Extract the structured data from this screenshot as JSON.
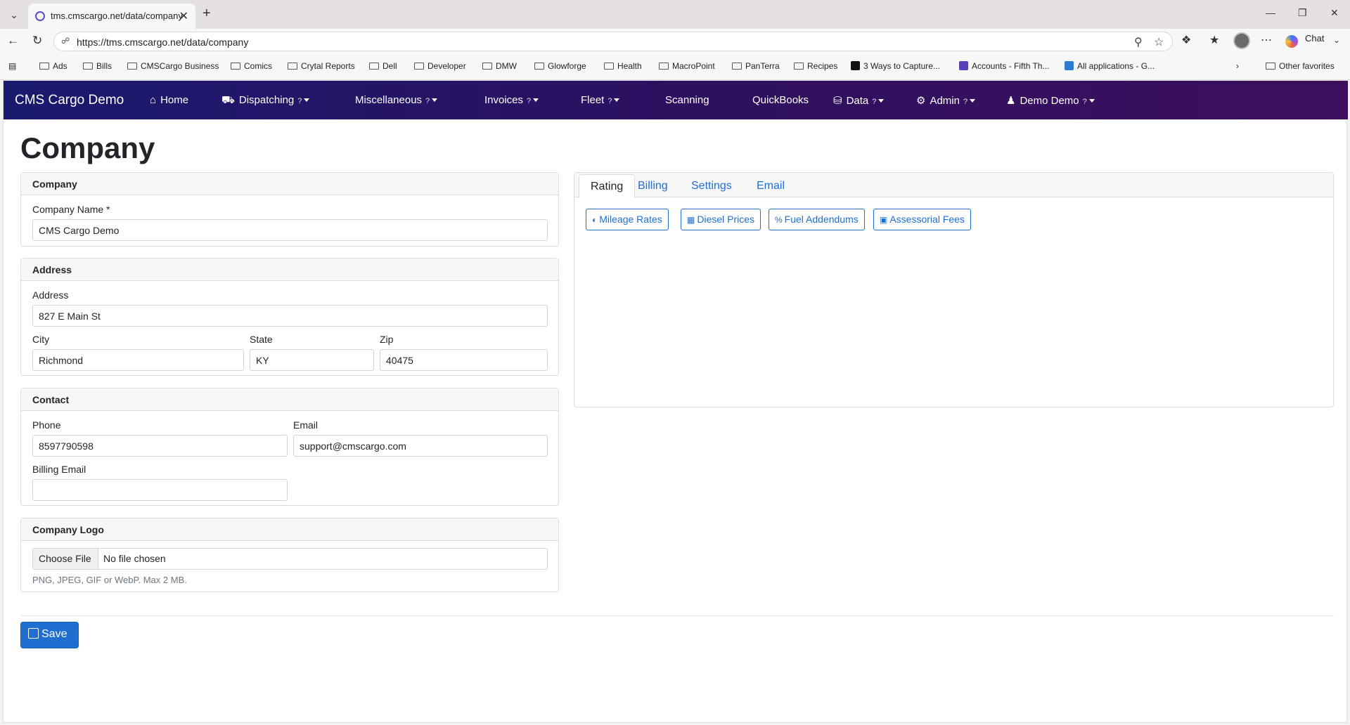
{
  "browser": {
    "tab_title": "tms.cmscargo.net/data/company",
    "url": "https://tms.cmscargo.net/data/company",
    "chat_label": "Chat",
    "bookmarks": [
      "Ads",
      "Bills",
      "CMSCargo Business",
      "Comics",
      "Crytal Reports",
      "Dell",
      "Developer",
      "DMW",
      "Glowforge",
      "Health",
      "MacroPoint",
      "PanTerra",
      "Recipes",
      "3 Ways to Capture...",
      "Accounts - Fifth Th...",
      "All applications - G..."
    ],
    "other_favorites": "Other favorites"
  },
  "navbar": {
    "brand": "CMS Cargo Demo",
    "home": "Home",
    "dispatching": "Dispatching",
    "miscellaneous": "Miscellaneous",
    "invoices": "Invoices",
    "fleet": "Fleet",
    "scanning": "Scanning",
    "quickbooks": "QuickBooks",
    "data": "Data",
    "admin": "Admin",
    "user": "Demo Demo",
    "help_mark": "?"
  },
  "page": {
    "title": "Company",
    "company_card": {
      "header": "Company",
      "name_label": "Company Name *",
      "name_value": "CMS Cargo Demo"
    },
    "address_card": {
      "header": "Address",
      "address_label": "Address",
      "address_value": "827 E Main St",
      "city_label": "City",
      "city_value": "Richmond",
      "state_label": "State",
      "state_value": "KY",
      "zip_label": "Zip",
      "zip_value": "40475"
    },
    "contact_card": {
      "header": "Contact",
      "phone_label": "Phone",
      "phone_value": "8597790598",
      "email_label": "Email",
      "email_value": "support@cmscargo.com",
      "billing_email_label": "Billing Email",
      "billing_email_value": ""
    },
    "logo_card": {
      "header": "Company Logo",
      "choose_file": "Choose File",
      "no_file": "No file chosen",
      "hint": "PNG, JPEG, GIF or WebP. Max 2 MB."
    },
    "tabs": [
      "Rating",
      "Billing",
      "Settings",
      "Email"
    ],
    "rating_buttons": [
      "Mileage Rates",
      "Diesel Prices",
      "Fuel Addendums",
      "Assessorial Fees"
    ],
    "save_label": "Save"
  },
  "colors": {
    "nav_start": "#1a1a6e",
    "nav_end": "#3d0f5c",
    "primary": "#1f6fd1"
  }
}
